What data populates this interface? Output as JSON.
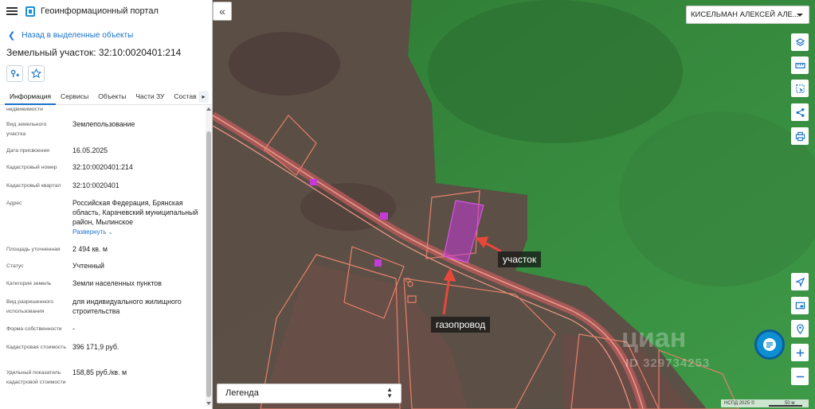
{
  "app": {
    "title": "Геоинформационный портал"
  },
  "panel": {
    "back_label": "Назад в выделенные объекты",
    "title": "Земельный участок: 32:10:0020401:214",
    "tabs": [
      "Информация",
      "Сервисы",
      "Объекты",
      "Части ЗУ",
      "Состав"
    ],
    "active_tab": "Информация",
    "cut_label": "недвижимости",
    "rows": [
      {
        "label": "Вид земельного участка",
        "value": "Землепользование"
      },
      {
        "label": "Дата присвоения",
        "value": "16.05.2025"
      },
      {
        "label": "Кадастровый номер",
        "value": "32:10:0020401:214"
      },
      {
        "label": "Кадастровый квартал",
        "value": "32:10:0020401"
      },
      {
        "label": "Адрес",
        "value": "Российская Федерация, Брянская область, Карачевский муниципальный район, Мылинское"
      },
      {
        "label": "Площадь уточненная",
        "value": "2 494 кв. м"
      },
      {
        "label": "Статус",
        "value": "Учтенный"
      },
      {
        "label": "Категория земель",
        "value": "Земли населенных пунктов"
      },
      {
        "label": "Вид разрешенного использования",
        "value": "для индивидуального жилищного строительства"
      },
      {
        "label": "Форма собственности",
        "value": "-"
      },
      {
        "label": "Кадастровая стоимость",
        "value": "396 171,9 руб."
      },
      {
        "label": "Удельный показатель кадастровой стоимости",
        "value": "158,85 руб./кв. м"
      }
    ],
    "expand_label": "Развернуть"
  },
  "map": {
    "user": "КИСЕЛЬМАН АЛЕКСЕЙ АЛЕ...",
    "legend": "Легенда",
    "annotations": {
      "plot": "участок",
      "pipeline": "газопровод"
    },
    "watermark": "циан",
    "watermark_id": "ID 329734253",
    "attribution": "НСПД 2025 ©",
    "scale": "50 м",
    "icons": [
      "layers-icon",
      "ruler-icon",
      "select-area-icon",
      "share-icon",
      "print-icon",
      "navigate-icon",
      "screen-icon",
      "location-icon",
      "zoom-in-icon",
      "zoom-out-icon"
    ]
  },
  "colors": {
    "accent": "#1a73c8",
    "map_green": "#3d8c3d",
    "parcel_outline": "#e8806a",
    "plot_fill": "#c53bd6"
  }
}
